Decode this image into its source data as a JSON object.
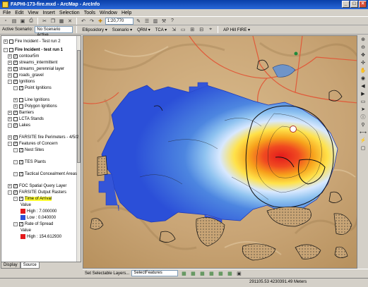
{
  "window": {
    "title": "FAPHI-173-fire.mxd - ArcMap - ArcInfo",
    "controls": [
      "_",
      "□",
      "×"
    ]
  },
  "menu": [
    "File",
    "Edit",
    "View",
    "Insert",
    "Selection",
    "Tools",
    "Window",
    "Help"
  ],
  "toolbar": {
    "scale": "1:20,770"
  },
  "scenario_bar": {
    "label": "Active Scenario:",
    "value": "No Scenario Active",
    "menus": [
      "Ellipsoidory ▾",
      "Scenario ▾",
      "QRM ▾",
      "TCA ▾"
    ],
    "fire": "AP Hill FIRE ▾"
  },
  "toc": {
    "items": [
      {
        "label": "Fire Incident - Test run 2",
        "level": 0,
        "pm": "+",
        "cb": false
      },
      {
        "label": "Fire Incident - test run 1",
        "level": 0,
        "pm": "-",
        "cb": false,
        "bold": true
      },
      {
        "label": "contour5m",
        "level": 1,
        "pm": "+",
        "cb": true
      },
      {
        "label": "streams_intermittent",
        "level": 1,
        "pm": "+",
        "cb": true
      },
      {
        "label": "streams_perennial layer",
        "level": 1,
        "pm": "+",
        "cb": true
      },
      {
        "label": "roads_gravel",
        "level": 1,
        "pm": "+",
        "cb": false
      },
      {
        "label": "Ignitions",
        "level": 1,
        "pm": "-",
        "cb": true
      },
      {
        "label": "Point Ignitions",
        "level": 2,
        "pm": "-",
        "cb": true
      },
      {
        "label": "Line Ignitions",
        "level": 2,
        "pm": "+",
        "cb": false
      },
      {
        "label": "Polygon Ignitions",
        "level": 2,
        "pm": "+",
        "cb": false
      },
      {
        "label": "Barriers",
        "level": 1,
        "pm": "+",
        "cb": true
      },
      {
        "label": "LCTA Stands",
        "level": 1,
        "pm": "+",
        "cb": false
      },
      {
        "label": "Lakes",
        "level": 1,
        "pm": "-",
        "cb": true
      },
      {
        "label": "FARSITE fire Perimeters - 4/5/2",
        "level": 1,
        "pm": "+",
        "cb": true
      },
      {
        "label": "Features of Concern",
        "level": 1,
        "pm": "-",
        "cb": true
      },
      {
        "label": "Nest Sites",
        "level": 2,
        "pm": "-",
        "cb": true
      },
      {
        "label": "TES Plants",
        "level": 2,
        "pm": "-",
        "cb": true
      },
      {
        "label": "Tactical Concealment Areas",
        "level": 2,
        "pm": "-",
        "cb": true
      },
      {
        "label": "FOC Spatial Query Layer",
        "level": 1,
        "pm": "+",
        "cb": true
      },
      {
        "label": "FARSITE Output Rasters",
        "level": 1,
        "pm": "-",
        "cb": true
      },
      {
        "label": "Time of Arrival",
        "level": 2,
        "pm": "-",
        "cb": true,
        "selected": true
      },
      {
        "label": "Value",
        "level": 3
      },
      {
        "label": "High : 7.000000",
        "level": 3
      },
      {
        "label": "Low : 0.040000",
        "level": 3
      },
      {
        "label": "Rate of Spread",
        "level": 2,
        "pm": "-",
        "cb": true
      },
      {
        "label": "Value",
        "level": 3
      },
      {
        "label": "High : 154.612930",
        "level": 3
      }
    ]
  },
  "toc_tabs": [
    "Display",
    "Source"
  ],
  "drawbar": {
    "label": "Set Selectable Layers...",
    "dropdown": "SelectFeatures"
  },
  "status": {
    "coords": "291105.53  4230391.49 Meters"
  },
  "colors": {
    "title_bar": "#0a3fa8",
    "selected_layer": "#ffff33",
    "ramp_high": "#e31a1c",
    "ramp_low": "#2b4fd8"
  }
}
